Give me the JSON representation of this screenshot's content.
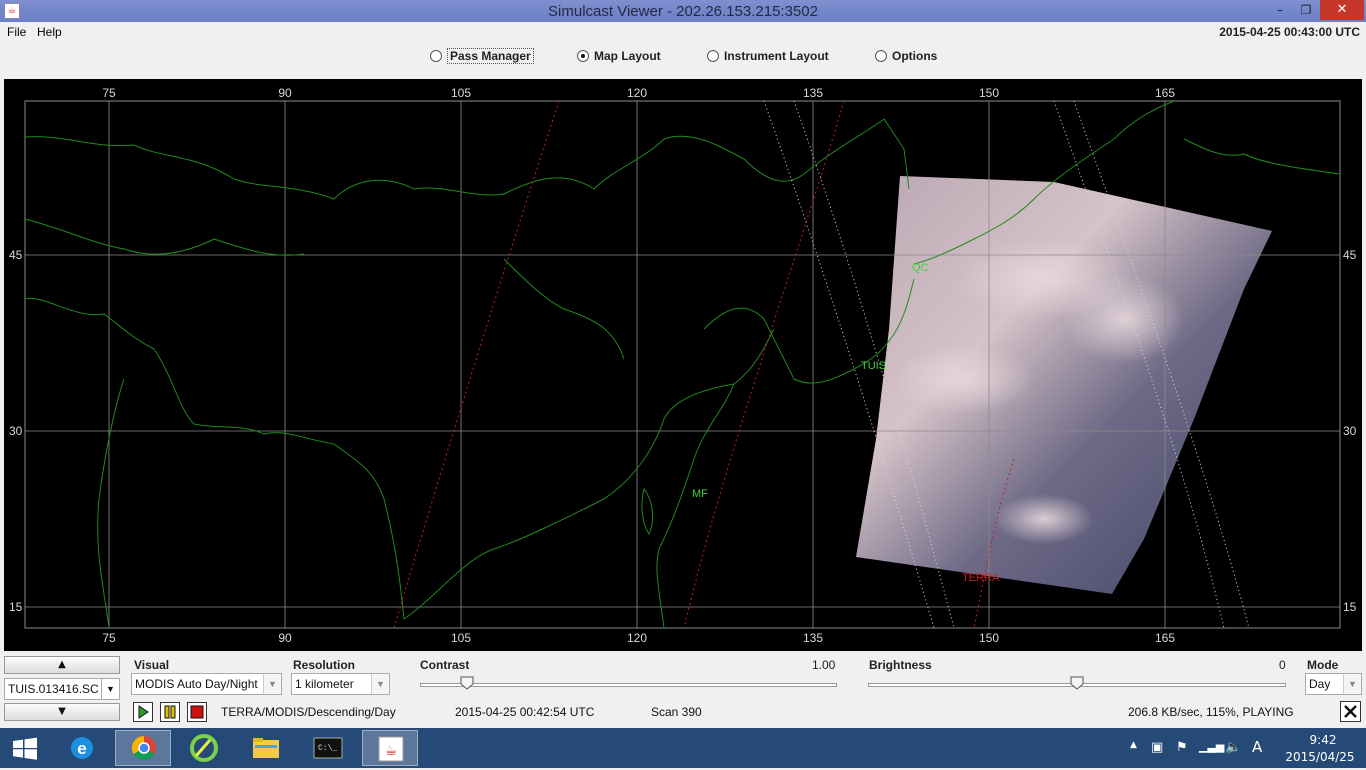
{
  "window": {
    "title": "Simulcast Viewer - 202.26.153.215:3502",
    "min_glyph": "–",
    "max_glyph": "❐",
    "close_glyph": "✕"
  },
  "menu": {
    "file": "File",
    "help": "Help"
  },
  "utc_clock": "2015-04-25 00:43:00 UTC",
  "tabs": [
    {
      "label": "Pass Manager",
      "selected": false
    },
    {
      "label": "Map Layout",
      "selected": true
    },
    {
      "label": "Instrument Layout",
      "selected": false
    },
    {
      "label": "Options",
      "selected": false
    }
  ],
  "map": {
    "lon_labels": [
      "75",
      "90",
      "105",
      "120",
      "135",
      "150",
      "165"
    ],
    "lat_labels": [
      "45",
      "30",
      "15"
    ],
    "stations": [
      {
        "name": "QC",
        "color": "#3fd23f"
      },
      {
        "name": "TUIS",
        "color": "#3fd23f"
      },
      {
        "name": "MF",
        "color": "#3fd23f"
      }
    ],
    "satellite_label": "TERRA",
    "satellite_color": "#d02020",
    "coast_color": "#1f8a1f",
    "grid_color": "#8c8c8c"
  },
  "controls": {
    "pass_file": "TUIS.013416.SC",
    "visual_label": "Visual",
    "visual_value": "MODIS Auto Day/Night",
    "resolution_label": "Resolution",
    "resolution_value": "1 kilometer",
    "contrast_label": "Contrast",
    "contrast_value": "1.00",
    "contrast_level": 0.1,
    "brightness_label": "Brightness",
    "brightness_value": "0",
    "brightness_level": 0.5,
    "mode_label": "Mode",
    "mode_value": "Day"
  },
  "status": {
    "pass_desc": "TERRA/MODIS/Descending/Day",
    "scan_time": "2015-04-25 00:42:54 UTC",
    "scan": "Scan 390",
    "rate": "206.8 KB/sec, 115%, PLAYING"
  },
  "taskbar": {
    "time": "9:42",
    "date": "2015/04/25",
    "ime": "A"
  }
}
